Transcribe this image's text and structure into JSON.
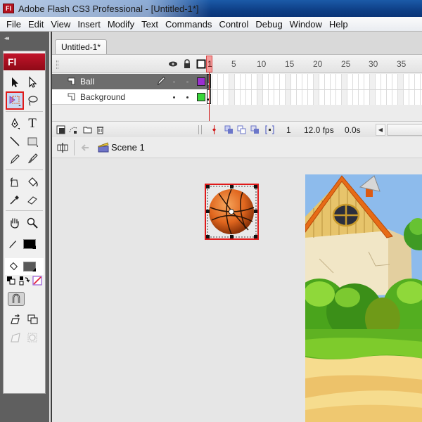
{
  "window": {
    "title": "Adobe Flash CS3 Professional - [Untitled-1*]",
    "app_icon_label": "Fl"
  },
  "menubar": {
    "items": [
      "File",
      "Edit",
      "View",
      "Insert",
      "Modify",
      "Text",
      "Commands",
      "Control",
      "Debug",
      "Window",
      "Help"
    ]
  },
  "tools": {
    "logo": "Fl",
    "collapse_glyph": "◂◂",
    "selected_tool": "free-transform",
    "items": [
      {
        "name": "selection-tool",
        "glyph": "arrow"
      },
      {
        "name": "subselection-tool",
        "glyph": "hollow-arrow"
      },
      {
        "name": "free-transform-tool",
        "glyph": "transform"
      },
      {
        "name": "lasso-tool",
        "glyph": "lasso"
      },
      {
        "name": "pen-tool",
        "glyph": "pen"
      },
      {
        "name": "text-tool",
        "glyph": "T"
      },
      {
        "name": "line-tool",
        "glyph": "line"
      },
      {
        "name": "rectangle-tool",
        "glyph": "rect"
      },
      {
        "name": "pencil-tool",
        "glyph": "pencil"
      },
      {
        "name": "brush-tool",
        "glyph": "brush"
      },
      {
        "name": "ink-bottle-tool",
        "glyph": "ink"
      },
      {
        "name": "paint-bucket-tool",
        "glyph": "bucket"
      },
      {
        "name": "eyedropper-tool",
        "glyph": "eyedropper"
      },
      {
        "name": "eraser-tool",
        "glyph": "eraser"
      },
      {
        "name": "hand-tool",
        "glyph": "hand"
      },
      {
        "name": "zoom-tool",
        "glyph": "zoom"
      }
    ],
    "stroke_color": "#000000",
    "fill_color": "#5a5a5a"
  },
  "document": {
    "tab_label": "Untitled-1*"
  },
  "timeline": {
    "frame_numbers": [
      "1",
      "5",
      "10",
      "15",
      "20",
      "25",
      "30",
      "35"
    ],
    "layers": [
      {
        "name": "Ball",
        "active": true,
        "color": "#9b2fd0"
      },
      {
        "name": "Background",
        "active": false,
        "color": "#38d63a"
      }
    ],
    "footer": {
      "current_frame": "1",
      "frame_rate": "12.0 fps",
      "elapsed_time": "0.0s"
    }
  },
  "editbar": {
    "scene_label": "Scene 1"
  },
  "colors": {
    "selection_highlight": "#e01a1a",
    "playhead": "#d01414"
  }
}
